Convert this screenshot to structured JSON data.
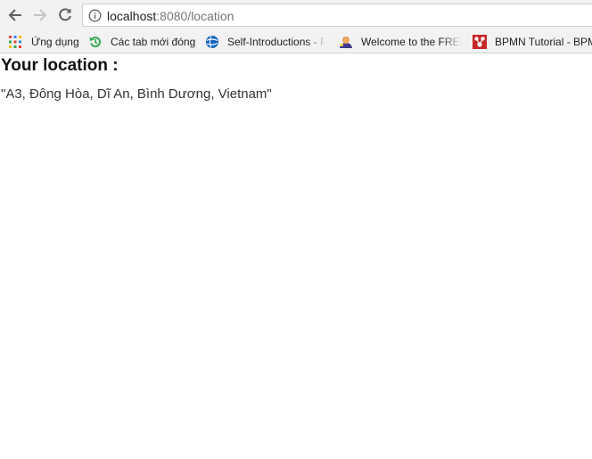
{
  "browser": {
    "url_host": "localhost",
    "url_rest": ":8080/location"
  },
  "bookmarks": [
    {
      "label": "Ứng dụng",
      "icon": "apps-grid-icon"
    },
    {
      "label": "Các tab mới đóng",
      "icon": "history-icon"
    },
    {
      "label": "Self-Introductions - F",
      "icon": "globe-icon"
    },
    {
      "label": "Welcome to the FREE",
      "icon": "avatar-icon"
    },
    {
      "label": "BPMN Tutorial - BPM",
      "icon": "bpmn-icon"
    }
  ],
  "page": {
    "heading": "Your location :",
    "location": "\"A3, Đông Hòa, Dĩ An, Bình Dương, Vietnam\""
  },
  "colors": {
    "toolbar_bg": "#f2f2f2",
    "page_bg": "#ffffff",
    "bpmn_red": "#c62828"
  }
}
